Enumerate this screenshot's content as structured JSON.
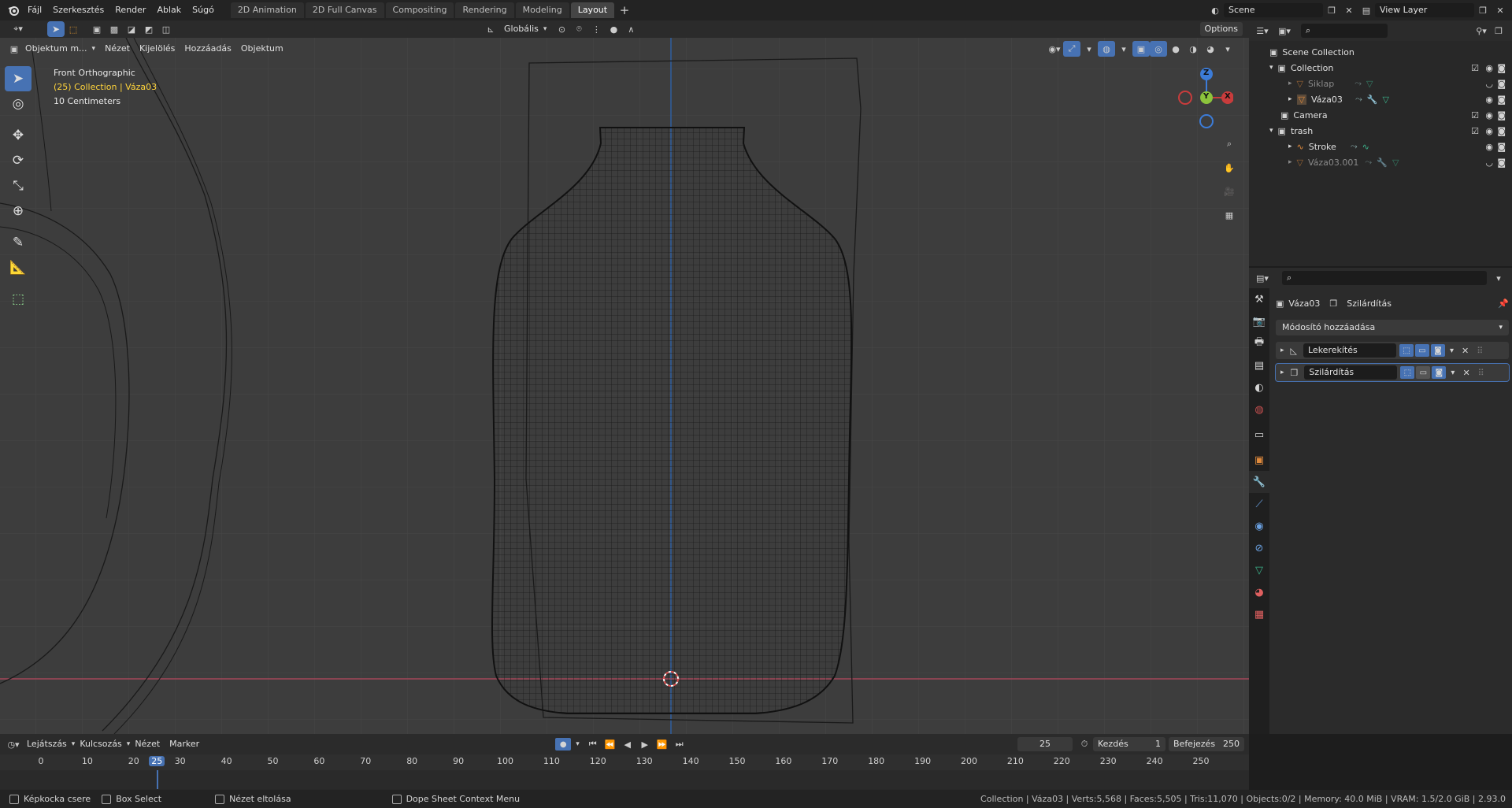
{
  "topbar": {
    "menus": [
      "Fájl",
      "Szerkesztés",
      "Render",
      "Ablak",
      "Súgó"
    ],
    "workspaces": [
      "2D Animation",
      "2D Full Canvas",
      "Compositing",
      "Rendering",
      "Modeling",
      "Layout"
    ],
    "active_workspace": "Layout",
    "scene": "Scene",
    "view_layer": "View Layer"
  },
  "viewport": {
    "mode": "Objektum m...",
    "menus": [
      "Nézet",
      "Kijelölés",
      "Hozzáadás",
      "Objektum"
    ],
    "orientation": "Globális",
    "options": "Options",
    "view_name": "Front Orthographic",
    "context": "(25) Collection | Váza03",
    "scale": "10 Centimeters",
    "gizmo": {
      "z": "Z",
      "y": "Y",
      "x": "X"
    }
  },
  "outliner": {
    "root": "Scene Collection",
    "items": [
      {
        "name": "Collection",
        "level": 0
      },
      {
        "name": "Siklap",
        "level": 1
      },
      {
        "name": "Váza03",
        "level": 1
      },
      {
        "name": "Camera",
        "level": 0
      },
      {
        "name": "trash",
        "level": 0
      },
      {
        "name": "Stroke",
        "level": 1
      },
      {
        "name": "Váza03.001",
        "level": 1
      }
    ]
  },
  "properties": {
    "object": "Váza03",
    "modifier_context": "Szilárdítás",
    "add_modifier": "Módosító hozzáadása",
    "modifiers": [
      {
        "name": "Lekerekítés"
      },
      {
        "name": "Szilárdítás"
      }
    ]
  },
  "timeline": {
    "menus": [
      "Lejátszás",
      "Kulcsozás",
      "Nézet",
      "Marker"
    ],
    "current_frame": "25",
    "start_label": "Kezdés",
    "start": "1",
    "end_label": "Befejezés",
    "end": "250",
    "ticks": [
      "0",
      "10",
      "20",
      "25",
      "30",
      "40",
      "50",
      "60",
      "70",
      "80",
      "90",
      "100",
      "110",
      "120",
      "130",
      "140",
      "150",
      "160",
      "170",
      "180",
      "190",
      "200",
      "210",
      "220",
      "230",
      "240",
      "250"
    ]
  },
  "statusbar": {
    "left1": "Képkocka csere",
    "left2": "Box Select",
    "left3": "Nézet eltolása",
    "left4": "Dope Sheet Context Menu",
    "right": "Collection | Váza03 | Verts:5,568 | Faces:5,505 | Tris:11,070 | Objects:0/2 | Memory: 40.0 MiB | VRAM: 1.5/2.0 GiB | 2.93.0"
  },
  "colors": {
    "accent": "#4772b3",
    "selected_text": "#ffd43b",
    "axis_red": "#c83c3c",
    "axis_green": "#8cc43c",
    "axis_blue": "#3c7cd8"
  }
}
